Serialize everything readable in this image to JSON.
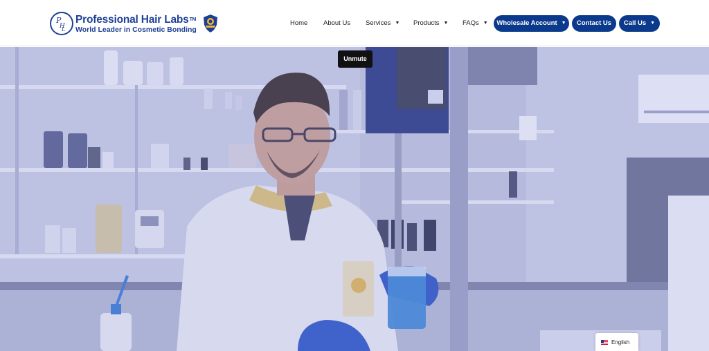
{
  "header": {
    "logo": {
      "title": "Professional Hair Labs",
      "trademark": "TM",
      "tagline": "World Leader in Cosmetic Bonding",
      "mark_icon": "phl-monogram-icon",
      "badge_icon": "shield-badge-icon"
    },
    "nav": {
      "home": "Home",
      "about": "About Us",
      "services": "Services",
      "products": "Products",
      "faqs": "FAQs",
      "caret_icon": "caret-down-icon"
    },
    "buttons": {
      "wholesale": "Wholesale Account",
      "contact": "Contact Us",
      "call": "Call Us"
    },
    "colors": {
      "brand": "#1d3f95",
      "button": "#0b3a8c"
    }
  },
  "hero": {
    "media": "lab-technician-video",
    "unmute_label": "Unmute"
  },
  "language": {
    "label": "English",
    "flag_icon": "us-flag-icon"
  }
}
